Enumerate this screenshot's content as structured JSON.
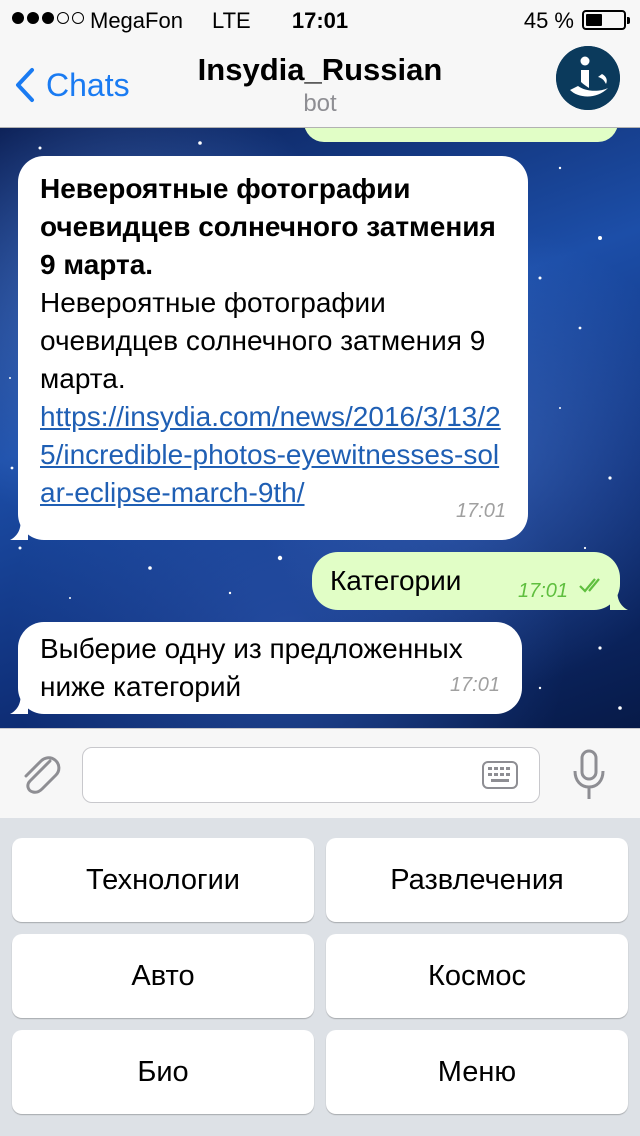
{
  "status_bar": {
    "carrier": "MegaFon",
    "network": "LTE",
    "time": "17:01",
    "battery_percent": "45 %",
    "battery_level": 0.45
  },
  "nav": {
    "back_label": "Chats",
    "title": "Insydia_Russian",
    "subtitle": "bot"
  },
  "messages": [
    {
      "direction": "incoming",
      "title": "Невероятные фотографии очевидцев солнечного затмения 9 марта.",
      "body": "Невероятные фотографии очевидцев солнечного затмения 9 марта.",
      "link": "https://insydia.com/news/2016/3/13/25/incredible-photos-eyewitnesses-solar-eclipse-march-9th/",
      "time": "17:01"
    },
    {
      "direction": "outgoing",
      "text": "Категории",
      "time": "17:01",
      "read": true
    },
    {
      "direction": "incoming",
      "text": "Выберие одну из предложенных ниже категорий",
      "time": "17:01"
    }
  ],
  "input": {
    "value": "",
    "placeholder": ""
  },
  "keyboard": {
    "buttons": [
      "Технологии",
      "Развлечения",
      "Авто",
      "Космос",
      "Био",
      "Меню"
    ]
  },
  "icons": {
    "back": "chevron-left-icon",
    "attach": "paperclip-icon",
    "keyboard": "keyboard-icon",
    "mic": "microphone-icon",
    "read_receipt": "double-check-icon"
  },
  "colors": {
    "accent": "#1a7bf2",
    "outgoing_bubble": "#e1fec6",
    "incoming_bubble": "#ffffff",
    "link": "#1f5fb4",
    "read_check": "#5fbf3f"
  }
}
